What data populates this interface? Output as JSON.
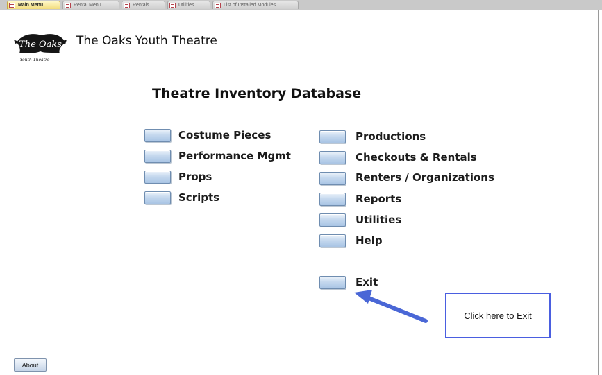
{
  "tabs": [
    {
      "label": "Main Menu",
      "active": true
    },
    {
      "label": "Rental Menu",
      "active": false
    },
    {
      "label": "Rentals",
      "active": false
    },
    {
      "label": "Utilities",
      "active": false
    },
    {
      "label": "List of Installed Modules",
      "active": false
    }
  ],
  "header": {
    "logo_text": "The Oaks",
    "logo_subtext": "Youth Theatre",
    "app_title": "The Oaks Youth Theatre"
  },
  "main": {
    "title": "Theatre Inventory Database",
    "left_menu": [
      "Costume Pieces",
      "Performance Mgmt",
      "Props",
      "Scripts"
    ],
    "right_menu": [
      "Productions",
      "Checkouts & Rentals",
      "Renters / Organizations",
      "Reports",
      "Utilities",
      "Help"
    ],
    "exit_label": "Exit"
  },
  "callout": {
    "text": "Click here to Exit"
  },
  "footer": {
    "about_label": "About"
  },
  "colors": {
    "button_face": "#c5d8ee",
    "callout_border": "#4a5ee0",
    "arrow": "#4a67d6",
    "active_tab": "#f2dc7c"
  }
}
